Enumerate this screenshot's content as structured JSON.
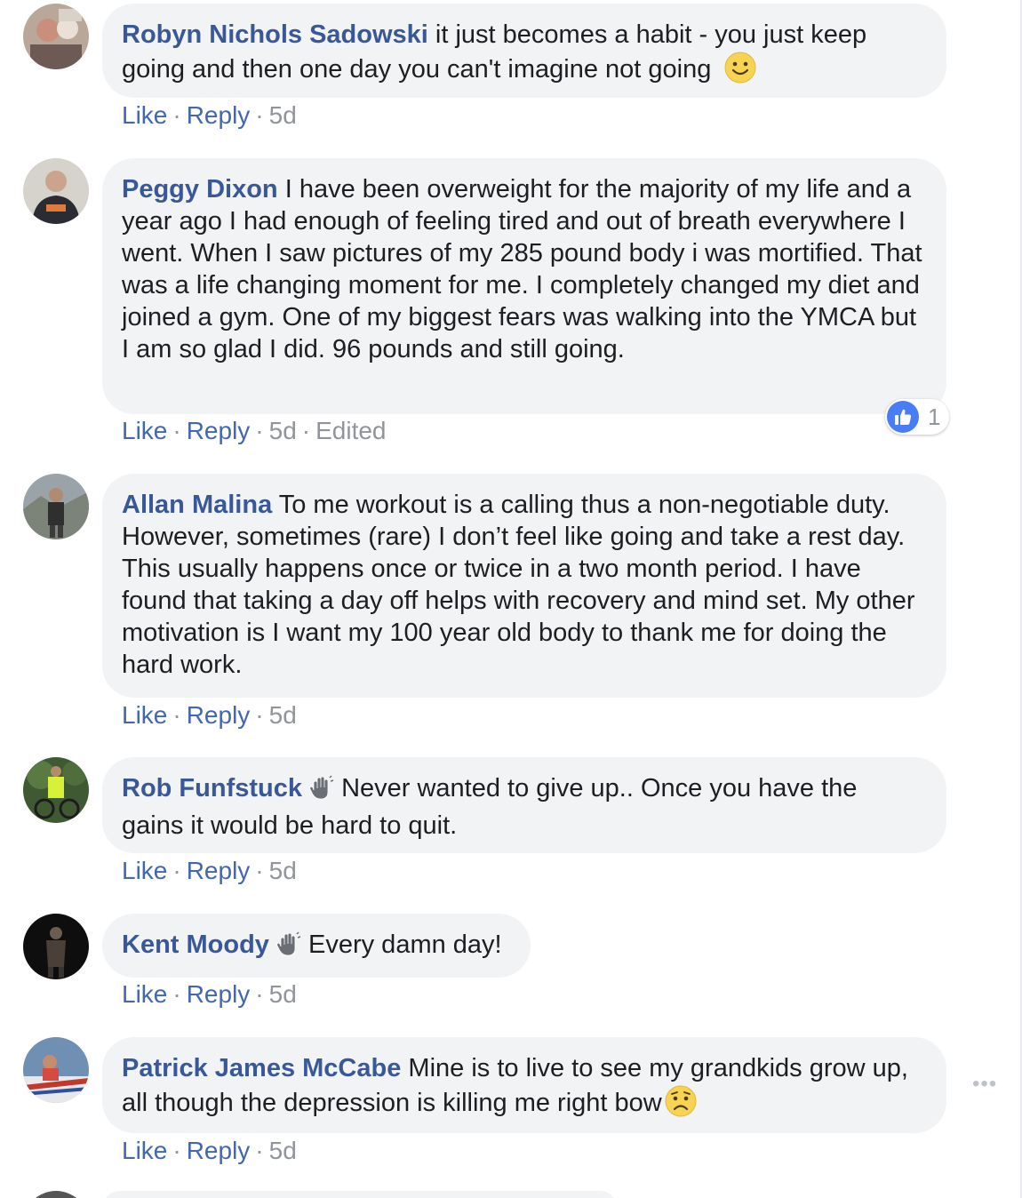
{
  "comments": [
    {
      "author": "Robyn Nichols Sadowski",
      "text": "it just becomes a habit - you just keep going and then one day you can't imagine not going",
      "emoji": "smile-emoji",
      "actions": {
        "like": "Like",
        "reply": "Reply",
        "time": "5d"
      }
    },
    {
      "author": "Peggy Dixon",
      "text": "I have been overweight for the majority of my life and a year ago I had enough of feeling tired and out of breath everywhere I went. When I saw pictures of my 285 pound body i was mortified. That was a life changing moment for me. I completely changed my diet and joined a gym. One of my biggest fears was walking into the YMCA but I am so glad I did. 96 pounds and still going.",
      "actions": {
        "like": "Like",
        "reply": "Reply",
        "time": "5d",
        "edited": "Edited"
      },
      "reactions": {
        "icon": "thumbs-up-icon",
        "count": "1"
      }
    },
    {
      "author": "Allan Malina",
      "text": "To me workout is a calling thus a non-negotiable duty. However, sometimes (rare) I don’t feel like going and take a rest day. This usually happens once or twice in a two month period. I have found that taking a day off helps with recovery and mind set. My other motivation is I want my 100 year old body to thank me for doing the hard work.",
      "actions": {
        "like": "Like",
        "reply": "Reply",
        "time": "5d"
      }
    },
    {
      "author": "Rob Funfstuck",
      "badge": "waving-hand-icon",
      "text": "Never wanted to give up.. Once you have the gains it would be hard to quit.",
      "actions": {
        "like": "Like",
        "reply": "Reply",
        "time": "5d"
      }
    },
    {
      "author": "Kent Moody",
      "badge": "waving-hand-icon",
      "text": "Every damn day!",
      "actions": {
        "like": "Like",
        "reply": "Reply",
        "time": "5d"
      }
    },
    {
      "author": "Patrick James McCabe",
      "text": "Mine is to live to see my grandkids grow up, all though the depression is killing me right bow",
      "emoji": "worried-emoji",
      "actions": {
        "like": "Like",
        "reply": "Reply",
        "time": "5d"
      }
    }
  ],
  "more_options": "•••",
  "colors": {
    "author_link": "#385898",
    "action_link": "#4267b2",
    "bubble_bg": "#f2f3f5",
    "meta_text": "#90949c",
    "like_blue": "#4a7cf6"
  }
}
